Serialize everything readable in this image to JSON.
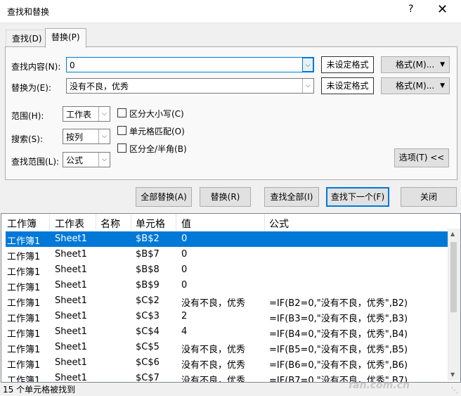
{
  "window": {
    "title": "查找和替换",
    "help": "?",
    "close": "✕"
  },
  "tabs": [
    {
      "label": "查找(D)"
    },
    {
      "label": "替换(P)"
    }
  ],
  "find": {
    "label": "查找内容(N):",
    "value": "0",
    "format_status": "未设定格式",
    "format_button": "格式(M)..."
  },
  "replace": {
    "label": "替换为(E):",
    "value": "没有不良，优秀",
    "format_status": "未设定格式",
    "format_button": "格式(M)..."
  },
  "scope": {
    "label": "范围(H):",
    "value": "工作表"
  },
  "search": {
    "label": "搜索(S):",
    "value": "按列"
  },
  "lookin": {
    "label": "查找范围(L):",
    "value": "公式"
  },
  "options": {
    "match_case": "区分大小写(C)",
    "whole_cell": "单元格匹配(O)",
    "byte_width": "区分全/半角(B)",
    "options_button": "选项(T) <<"
  },
  "actions": {
    "replace_all": "全部替换(A)",
    "replace": "替换(R)",
    "find_all": "查找全部(I)",
    "find_next": "查找下一个(F)",
    "close": "关闭"
  },
  "results": {
    "columns": [
      "工作簿",
      "工作表",
      "名称",
      "单元格",
      "值",
      "公式"
    ],
    "rows": [
      [
        "工作簿1",
        "Sheet1",
        "",
        "$B$2",
        "0",
        ""
      ],
      [
        "工作簿1",
        "Sheet1",
        "",
        "$B$7",
        "0",
        ""
      ],
      [
        "工作簿1",
        "Sheet1",
        "",
        "$B$8",
        "0",
        ""
      ],
      [
        "工作簿1",
        "Sheet1",
        "",
        "$B$9",
        "0",
        ""
      ],
      [
        "工作簿1",
        "Sheet1",
        "",
        "$C$2",
        "没有不良，优秀",
        "=IF(B2=0,\"没有不良，优秀\",B2)"
      ],
      [
        "工作簿1",
        "Sheet1",
        "",
        "$C$3",
        "2",
        "=IF(B3=0,\"没有不良，优秀\",B3)"
      ],
      [
        "工作簿1",
        "Sheet1",
        "",
        "$C$4",
        "4",
        "=IF(B4=0,\"没有不良，优秀\",B4)"
      ],
      [
        "工作簿1",
        "Sheet1",
        "",
        "$C$5",
        "没有不良，优秀",
        "=IF(B5=0,\"没有不良，优秀\",B5)"
      ],
      [
        "工作簿1",
        "Sheet1",
        "",
        "$C$6",
        "没有不良，优秀",
        "=IF(B6=0,\"没有不良，优秀\",B6)"
      ],
      [
        "工作簿1",
        "Sheet1",
        "",
        "$C$7",
        "没有不良，优秀",
        "=IF(B7=0,\"没有不良，优秀\",B7)"
      ]
    ],
    "selected_row": 0
  },
  "status": "15 个单元格被找到",
  "watermark": "fan.com.cn",
  "colors": {
    "accent": "#0078d7",
    "selection": "#0078d7",
    "background": "#f0f0f0"
  }
}
